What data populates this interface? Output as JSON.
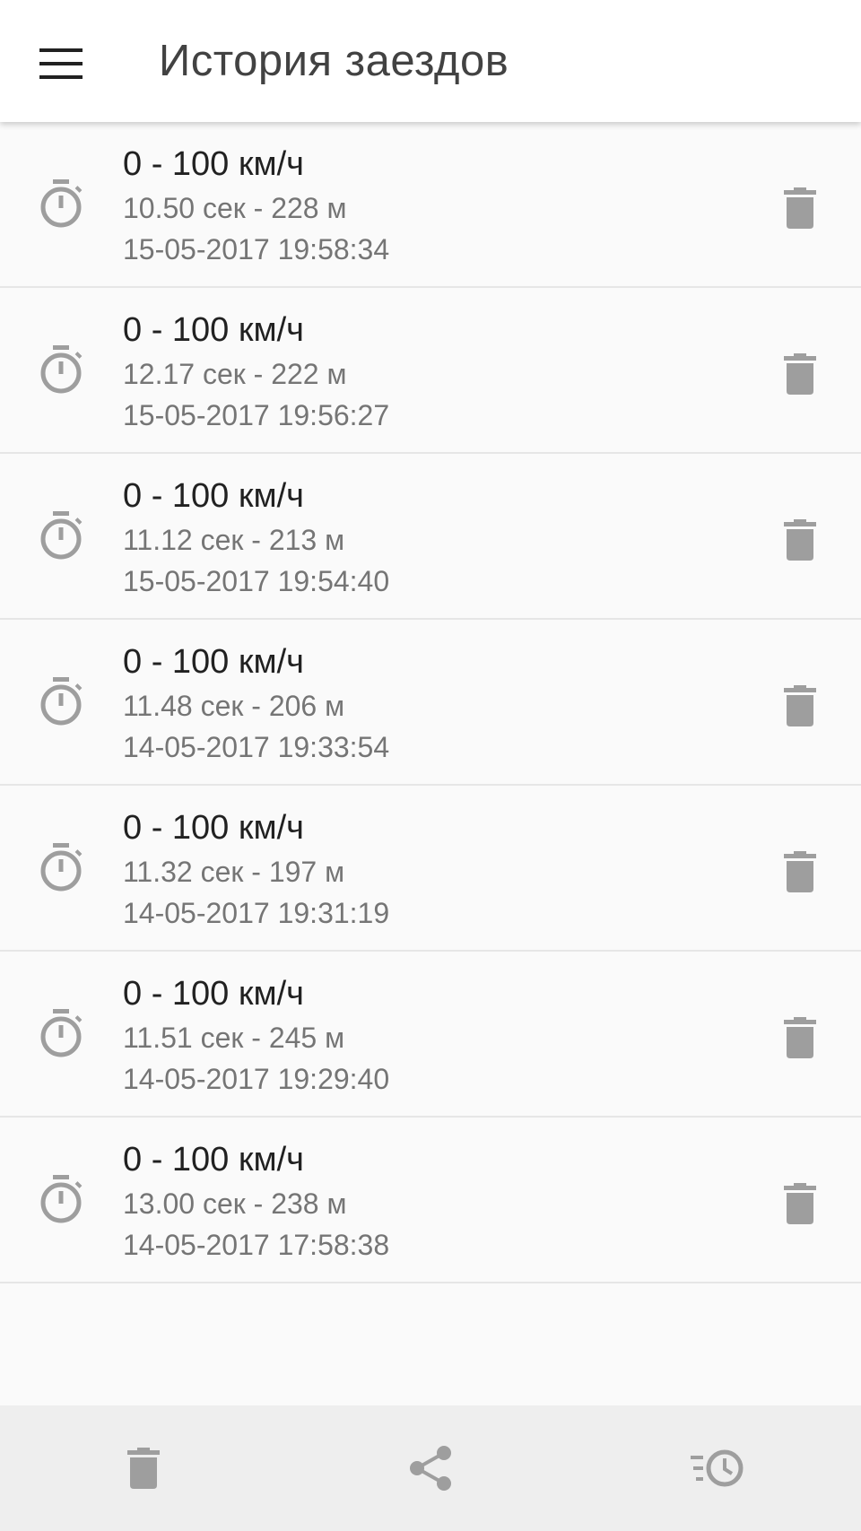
{
  "toolbar": {
    "menu_icon": "hamburger-menu-icon",
    "title": "История заездов"
  },
  "runs": [
    {
      "title": "0 - 100 км/ч",
      "result": "10.50 сек - 228 м",
      "date": "15-05-2017 19:58:34"
    },
    {
      "title": "0 - 100 км/ч",
      "result": "12.17 сек - 222 м",
      "date": "15-05-2017 19:56:27"
    },
    {
      "title": "0 - 100 км/ч",
      "result": "11.12 сек - 213 м",
      "date": "15-05-2017 19:54:40"
    },
    {
      "title": "0 - 100 км/ч",
      "result": "11.48 сек - 206 м",
      "date": "14-05-2017 19:33:54"
    },
    {
      "title": "0 - 100 км/ч",
      "result": "11.32 сек - 197 м",
      "date": "14-05-2017 19:31:19"
    },
    {
      "title": "0 - 100 км/ч",
      "result": "11.51 сек - 245 м",
      "date": "14-05-2017 19:29:40"
    },
    {
      "title": "0 - 100 км/ч",
      "result": "13.00 сек - 238 м",
      "date": "14-05-2017 17:58:38"
    }
  ],
  "row_icons": {
    "leading": "stopwatch-icon",
    "trailing": "trash-icon"
  },
  "bottom_bar": {
    "items": [
      "delete-all-icon",
      "share-icon",
      "history-icon"
    ]
  },
  "colors": {
    "toolbar_bg": "#ffffff",
    "page_bg": "#fafafa",
    "title_text": "#424242",
    "primary_text": "#212121",
    "secondary_text": "#757575",
    "icon_grey": "#9e9e9e",
    "bottom_bar_bg": "#eeeeee"
  }
}
